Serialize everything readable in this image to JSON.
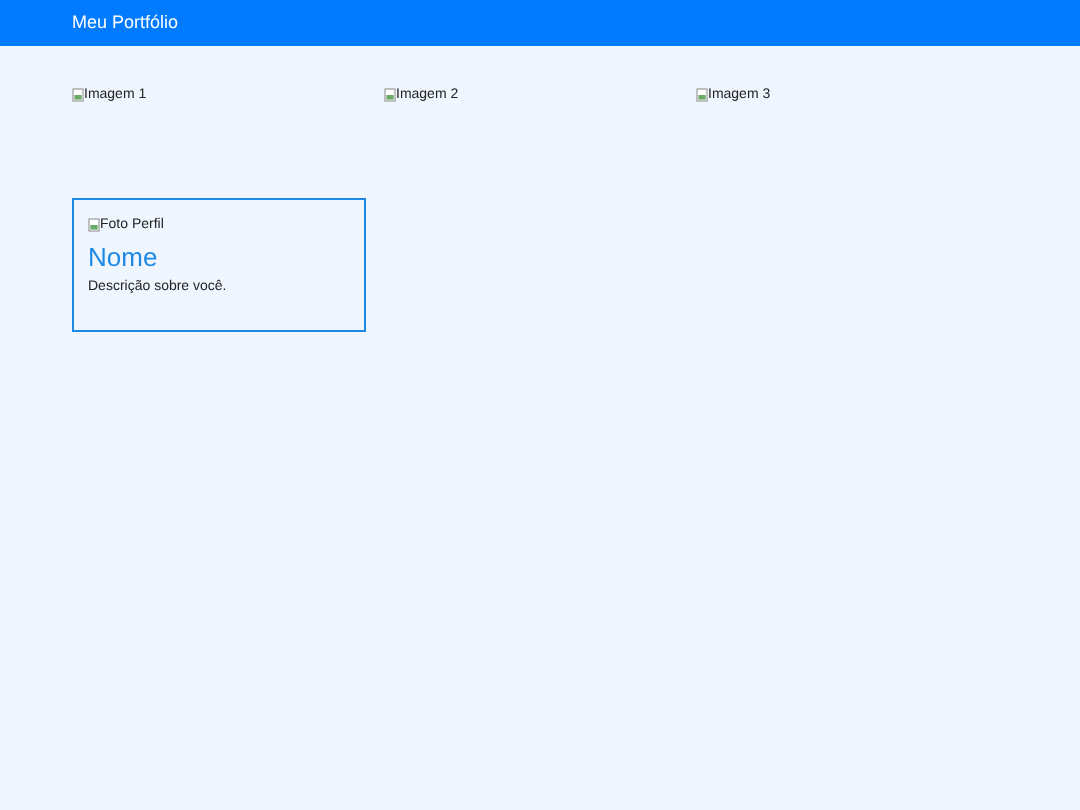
{
  "header": {
    "title": "Meu Portfólio"
  },
  "gallery": [
    {
      "alt": "Imagem 1"
    },
    {
      "alt": "Imagem 2"
    },
    {
      "alt": "Imagem 3"
    }
  ],
  "profile": {
    "photo_alt": "Foto Perfil",
    "name": "Nome",
    "description": "Descrição sobre você."
  }
}
